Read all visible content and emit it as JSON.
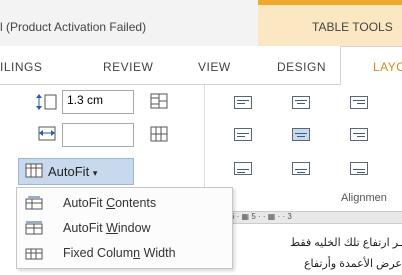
{
  "title": {
    "window_text": "l (Product Activation Failed)",
    "context_group": "TABLE TOOLS"
  },
  "tabs": [
    {
      "label": "ILINGS"
    },
    {
      "label": "REVIEW"
    },
    {
      "label": "VIEW"
    },
    {
      "label": "DESIGN"
    },
    {
      "label": "LAYO",
      "active": true
    }
  ],
  "cell_size": {
    "height_value": "1.3 cm",
    "width_value": ""
  },
  "autofit": {
    "label": "AutoFit",
    "menu": [
      {
        "pre": "AutoFit ",
        "key": "C",
        "post": "ontents",
        "icon": "autofit-contents-icon"
      },
      {
        "pre": "AutoFit ",
        "key": "W",
        "post": "indow",
        "icon": "autofit-window-icon"
      },
      {
        "pre": "Fixed Colum",
        "key": "n",
        "post": " Width",
        "icon": "fixed-column-width-icon"
      }
    ]
  },
  "alignment": {
    "group_label": "Alignmen",
    "selected": "middle-center"
  },
  "ruler_text": "6 · ▦ 5 · · ▦ · · 3",
  "document_lines": [
    "ـر ارتفاع تلك الخليه فقط",
    "عرض الأعمدة وأرتفاع"
  ],
  "colors": {
    "accent": "#f0a92f",
    "context_bg": "#fbe8c3",
    "button_selected": "#c8d9ee"
  }
}
